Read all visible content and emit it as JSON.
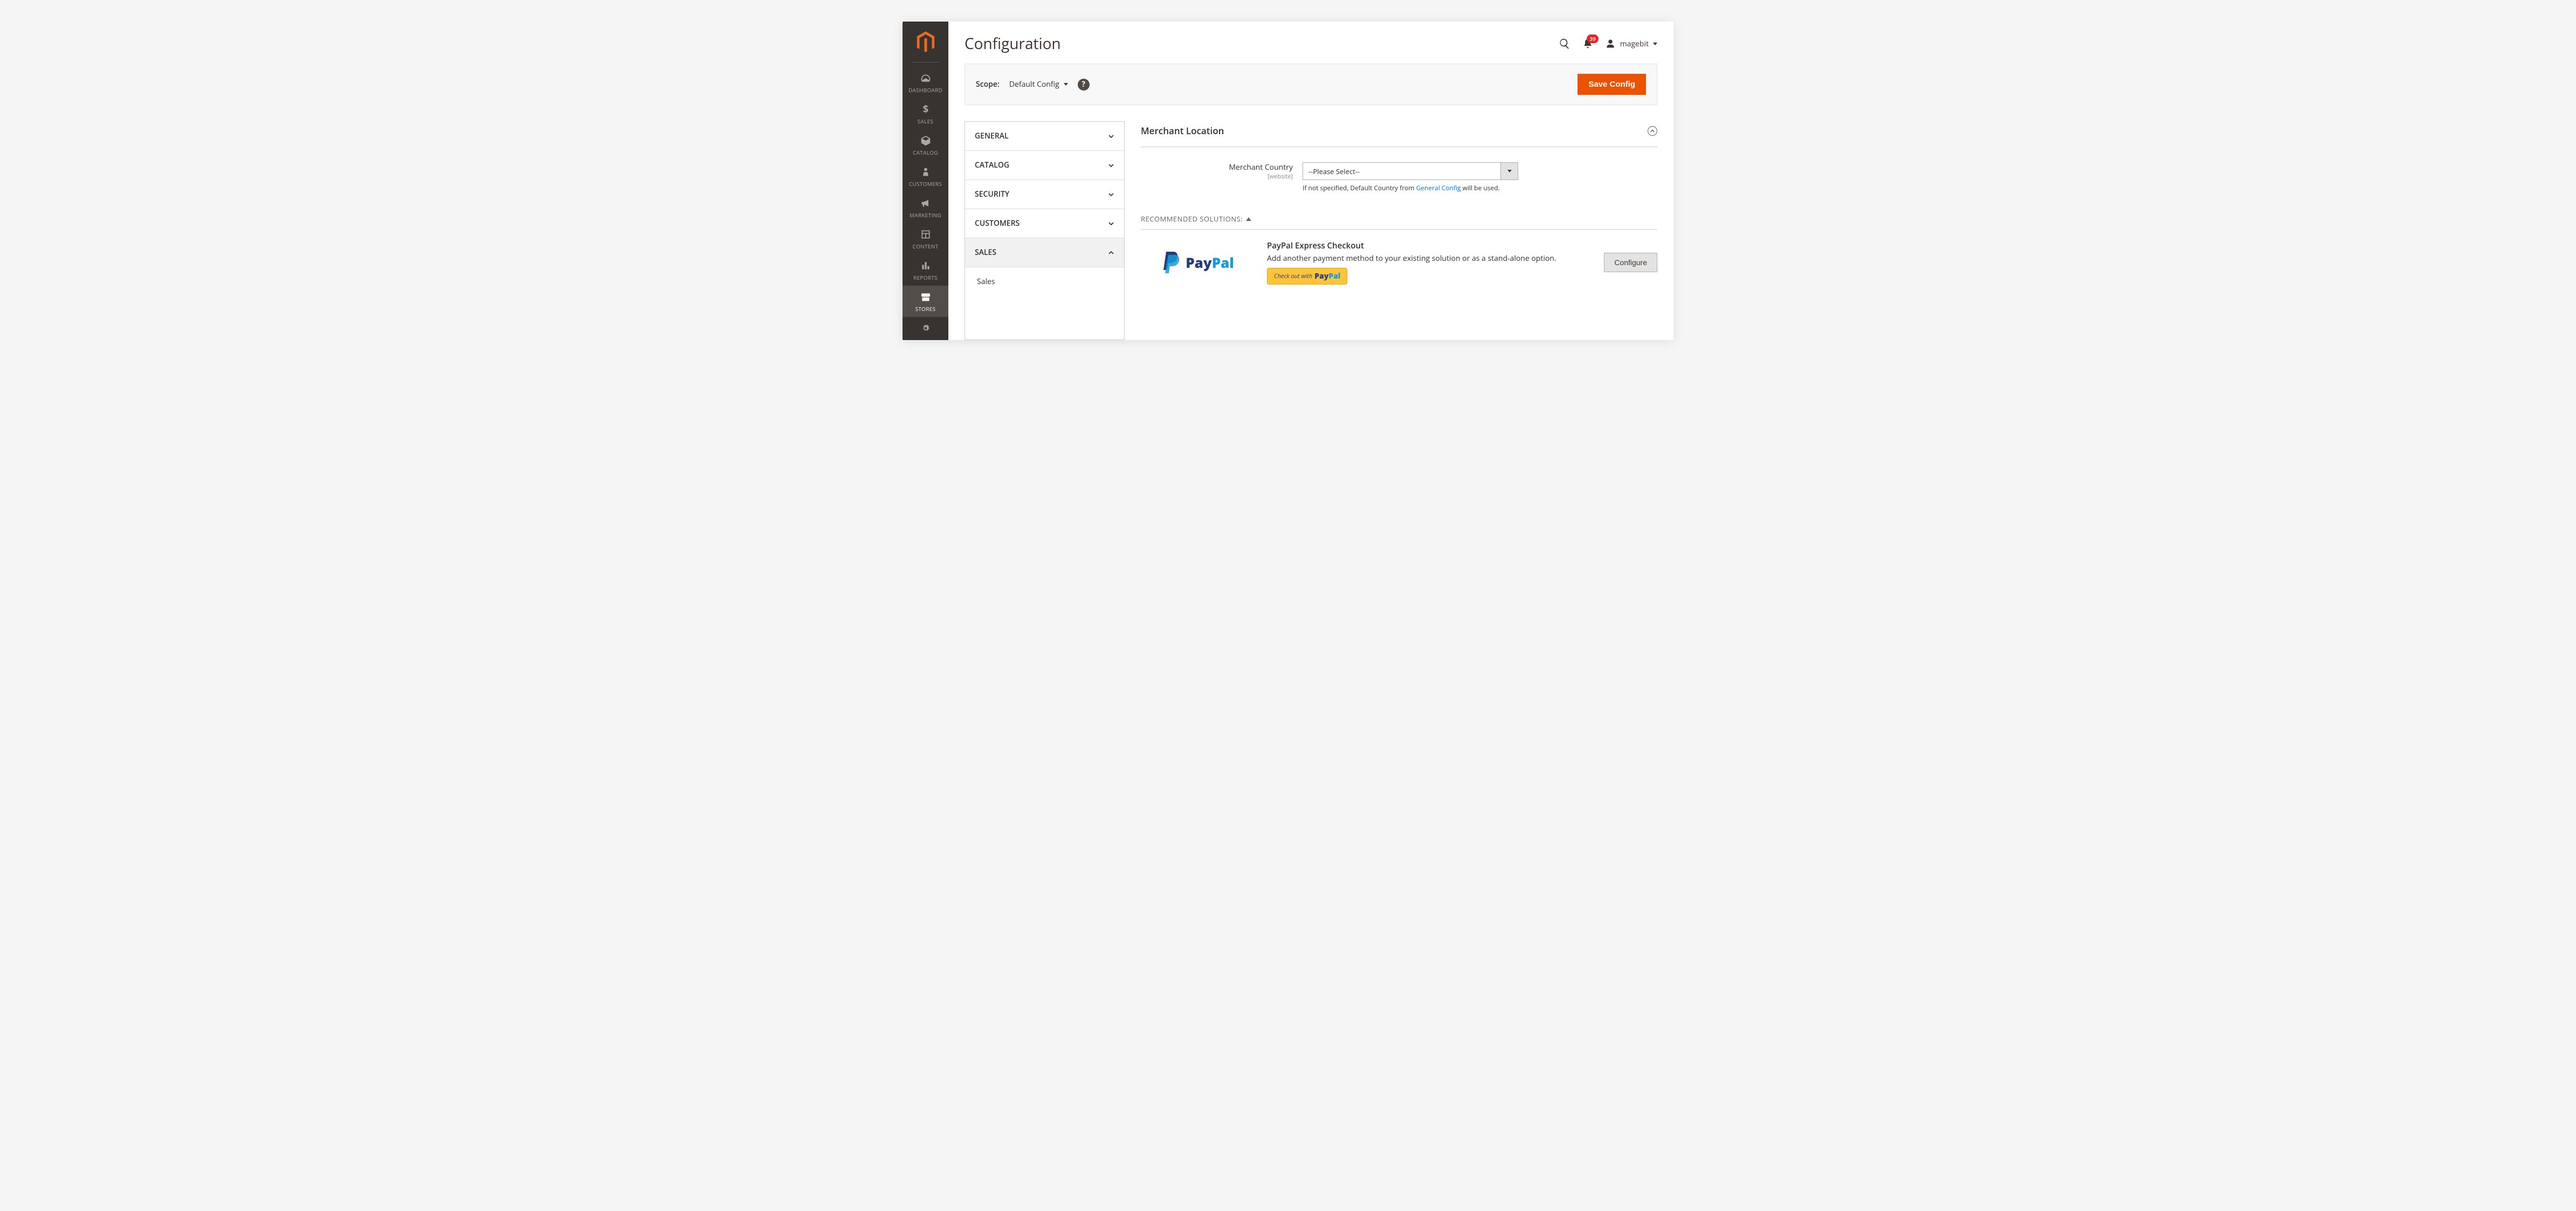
{
  "header": {
    "page_title": "Configuration",
    "notifications_count": "39",
    "username": "magebit"
  },
  "scope": {
    "label": "Scope:",
    "value": "Default Config",
    "save_label": "Save Config"
  },
  "sidebar": {
    "items": [
      {
        "label": "DASHBOARD"
      },
      {
        "label": "SALES"
      },
      {
        "label": "CATALOG"
      },
      {
        "label": "CUSTOMERS"
      },
      {
        "label": "MARKETING"
      },
      {
        "label": "CONTENT"
      },
      {
        "label": "REPORTS"
      },
      {
        "label": "STORES"
      }
    ]
  },
  "config_nav": {
    "items": [
      {
        "label": "GENERAL"
      },
      {
        "label": "CATALOG"
      },
      {
        "label": "SECURITY"
      },
      {
        "label": "CUSTOMERS"
      },
      {
        "label": "SALES"
      }
    ],
    "sub_item": "Sales"
  },
  "merchant_location": {
    "title": "Merchant Location",
    "field_label": "Merchant Country",
    "field_scope": "[website]",
    "select_placeholder": "--Please Select--",
    "note_prefix": "If not specified, Default Country from ",
    "note_link": "General Config",
    "note_suffix": " will be used."
  },
  "recommended": {
    "heading": "RECOMMENDED SOLUTIONS:",
    "paypal": {
      "title": "PayPal Express Checkout",
      "description": "Add another payment method to your existing solution or as a stand-alone option.",
      "checkout_badge_prefix": "Check out with",
      "configure_label": "Configure"
    }
  }
}
